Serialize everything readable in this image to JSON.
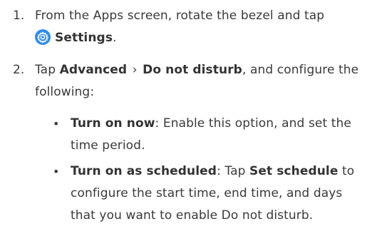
{
  "steps": [
    {
      "number": "1.",
      "text_before": "From the Apps screen, rotate the bezel and tap",
      "icon": "settings-gear-icon",
      "bold_after_icon": "Settings",
      "text_end": "."
    },
    {
      "number": "2.",
      "text_before": "Tap",
      "bold_1": "Advanced",
      "separator": "›",
      "bold_2": "Do not disturb",
      "text_end": ", and configure the following:"
    }
  ],
  "bullets": [
    {
      "dot": "•",
      "bold": "Turn on now",
      "text": ": Enable this option, and set the time period."
    },
    {
      "dot": "•",
      "bold": "Turn on as scheduled",
      "text_1": ": Tap",
      "bold_2": "Set schedule",
      "text_2": "to configure the start time, end time, and days that you want to enable Do not disturb."
    }
  ],
  "colors": {
    "text": "#3a3a3a",
    "icon_blue": "#2e8cf0"
  }
}
